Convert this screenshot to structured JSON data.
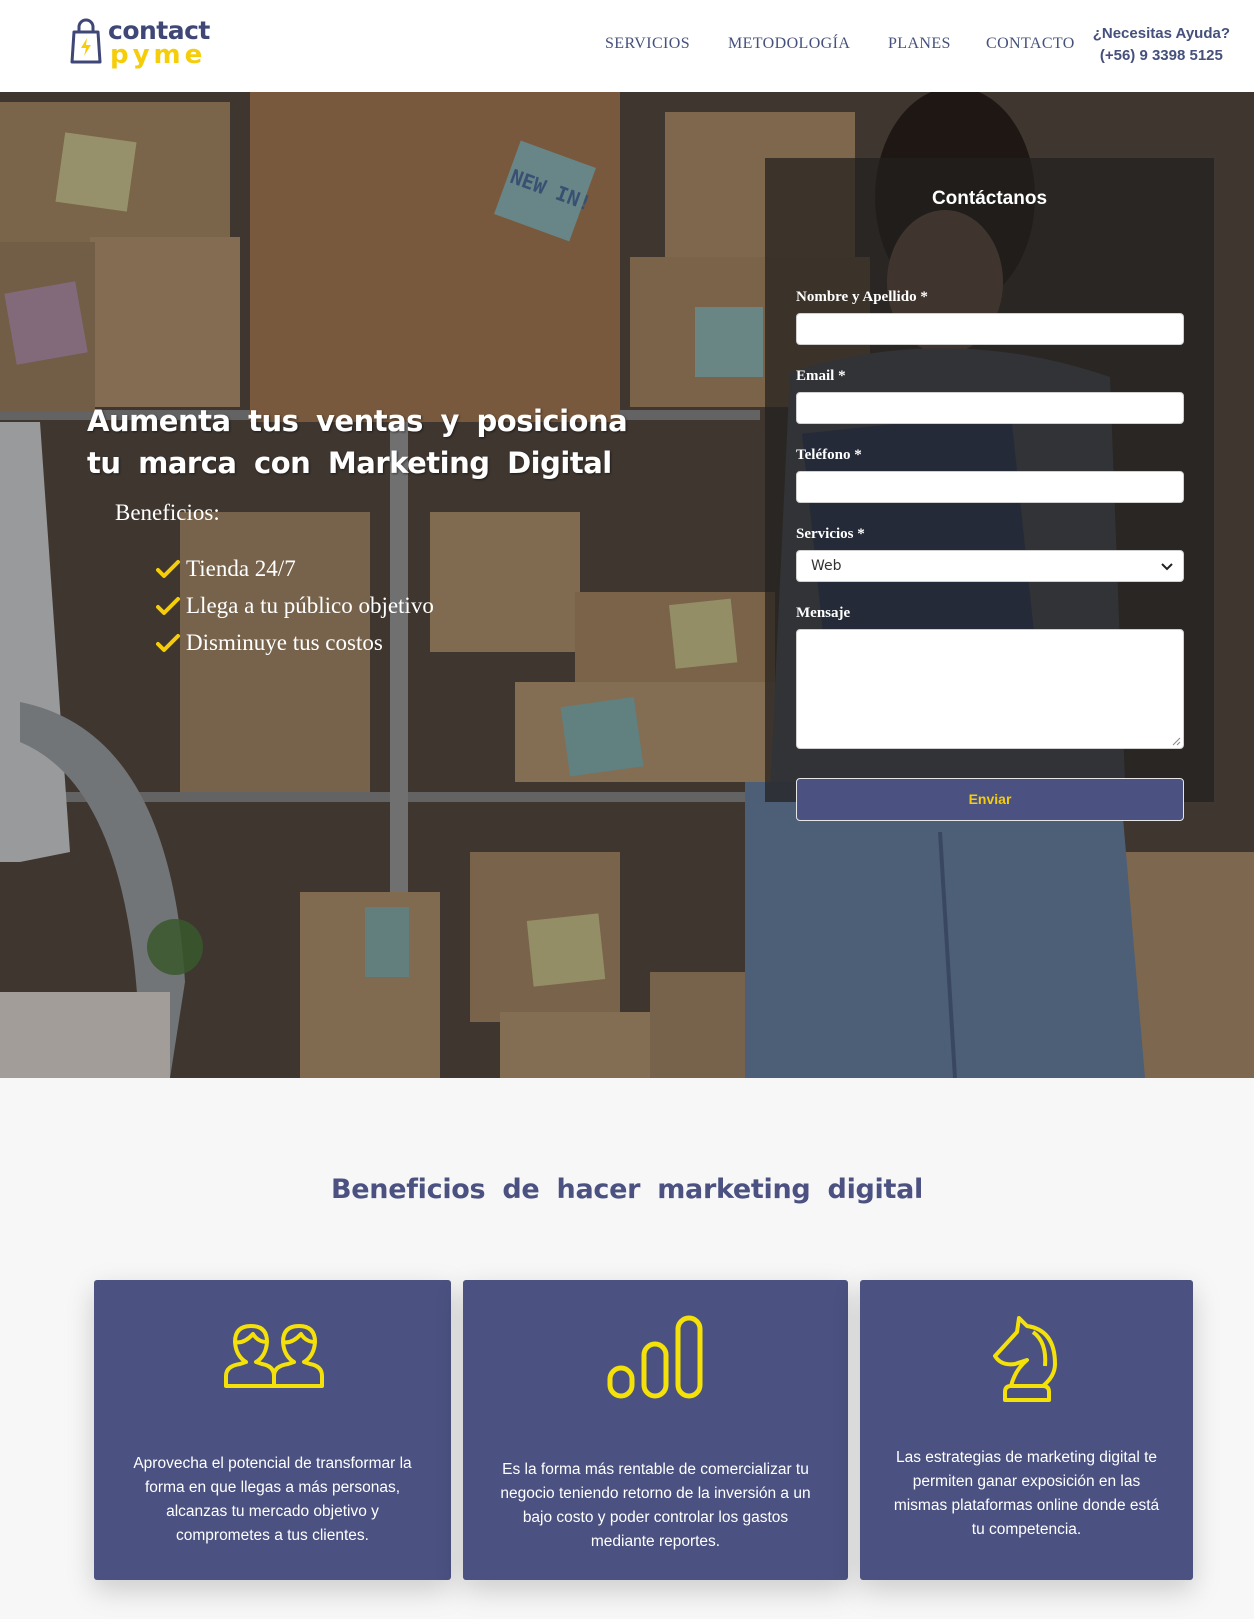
{
  "header": {
    "logo": {
      "word1": "contact",
      "word2": "pyme"
    },
    "nav": [
      {
        "label": "SERVICIOS"
      },
      {
        "label": "METODOLOGÍA"
      },
      {
        "label": "PLANES"
      },
      {
        "label": "CONTACTO"
      }
    ],
    "help": {
      "question": "¿Necesitas Ayuda?",
      "phone": "(+56) 9 3398 5125"
    }
  },
  "hero": {
    "title": "Aumenta tus ventas y posiciona tu marca con Marketing Digital",
    "benefits_heading": "Beneficios:",
    "benefits": [
      "Tienda 24/7",
      "Llega a tu público objetivo",
      "Disminuye tus costos"
    ],
    "sticky_note_text": "NEW IN!"
  },
  "form": {
    "title": "Contáctanos",
    "name_label": "Nombre y Apellido *",
    "email_label": "Email *",
    "phone_label": "Teléfono *",
    "services_label": "Servicios *",
    "services_selected": "Web",
    "message_label": "Mensaje",
    "submit_label": "Enviar"
  },
  "benefits_section": {
    "title": "Beneficios de hacer marketing digital",
    "cards": [
      {
        "icon": "users-icon",
        "text": "Aprovecha el potencial de transformar la forma en que llegas a más personas, alcanzas tu mercado objetivo y comprometes a tus clientes."
      },
      {
        "icon": "bar-chart-icon",
        "text": "Es la forma más rentable de comercializar tu negocio teniendo retorno de la inversión a un bajo costo y poder controlar los gastos mediante reportes."
      },
      {
        "icon": "chess-knight-icon",
        "text": "Las estrategias de marketing digital te permiten ganar exposición en las mismas plataformas online donde está tu competencia."
      }
    ]
  },
  "colors": {
    "brand_navy": "#4b5180",
    "brand_yellow": "#f5cd0a",
    "nav_text": "#45507c"
  }
}
